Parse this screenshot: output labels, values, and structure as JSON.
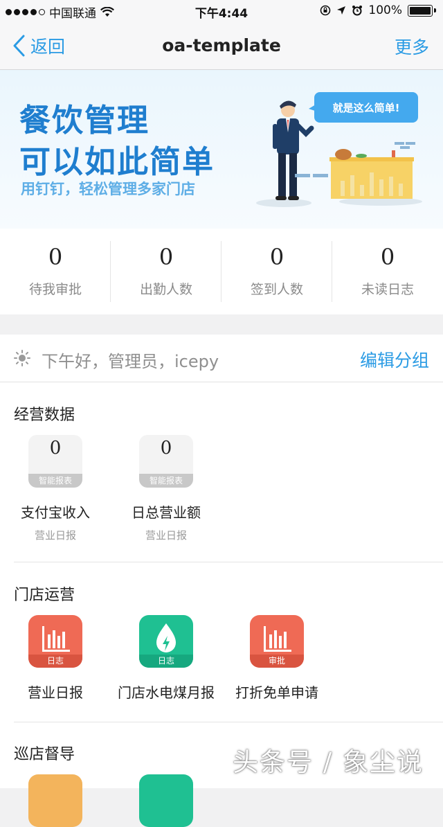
{
  "status_bar": {
    "carrier": "中国联通",
    "time": "下午4:44",
    "battery": "100%"
  },
  "nav": {
    "back": "返回",
    "title": "oa-template",
    "more": "更多"
  },
  "banner": {
    "line1": "餐饮管理",
    "line2": "可以如此简单",
    "tagline": "用钉钉，轻松管理多家门店",
    "bubble": "就是这么简单!"
  },
  "stats": [
    {
      "value": "0",
      "label": "待我审批"
    },
    {
      "value": "0",
      "label": "出勤人数"
    },
    {
      "value": "0",
      "label": "签到人数"
    },
    {
      "value": "0",
      "label": "未读日志"
    }
  ],
  "greeting": {
    "text": "下午好，管理员，icepy",
    "edit": "编辑分组"
  },
  "sections": {
    "business": {
      "title": "经营数据",
      "items": [
        {
          "value": "0",
          "badge": "智能报表",
          "name": "支付宝收入",
          "sub": "营业日报"
        },
        {
          "value": "0",
          "badge": "智能报表",
          "name": "日总营业额",
          "sub": "营业日报"
        }
      ]
    },
    "store_ops": {
      "title": "门店运营",
      "items": [
        {
          "badge": "日志",
          "name": "营业日报",
          "icon": "bar-chart-icon",
          "color": "#ef6a55"
        },
        {
          "badge": "日志",
          "name": "门店水电煤月报",
          "icon": "water-drop-icon",
          "color": "#1fc092"
        },
        {
          "badge": "审批",
          "name": "打折免单申请",
          "icon": "bar-chart-icon",
          "color": "#ef6a55"
        }
      ]
    },
    "patrol": {
      "title": "巡店督导"
    }
  },
  "watermark": "头条号 / 象尘说",
  "colors": {
    "accent": "#2a9be4",
    "banner_text": "#1f7ecf",
    "red": "#ef6a55",
    "green": "#1fc092",
    "orange": "#f3b45c"
  }
}
